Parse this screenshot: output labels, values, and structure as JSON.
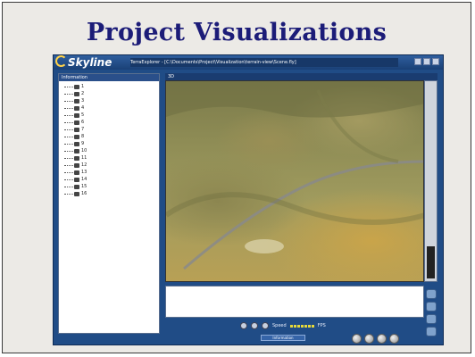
{
  "slide": {
    "title": "Project Visualizations"
  },
  "app": {
    "logo": "Skyline",
    "title_text": "TerraExplorer - [C:\\Documents\\Project\\Visualization\\terrain-view\\Scene.fly]",
    "tree_header": "Information",
    "tree_items": [
      {
        "label": "1"
      },
      {
        "label": "2"
      },
      {
        "label": "3"
      },
      {
        "label": "4"
      },
      {
        "label": "5"
      },
      {
        "label": "6"
      },
      {
        "label": "7"
      },
      {
        "label": "8"
      },
      {
        "label": "9"
      },
      {
        "label": "10"
      },
      {
        "label": "11"
      },
      {
        "label": "12"
      },
      {
        "label": "13"
      },
      {
        "label": "14"
      },
      {
        "label": "15"
      },
      {
        "label": "16"
      }
    ],
    "view_header": "3D",
    "status_tab": "Information",
    "toolbar": {
      "speed_label": "Speed",
      "fps_label": "FPS"
    }
  }
}
